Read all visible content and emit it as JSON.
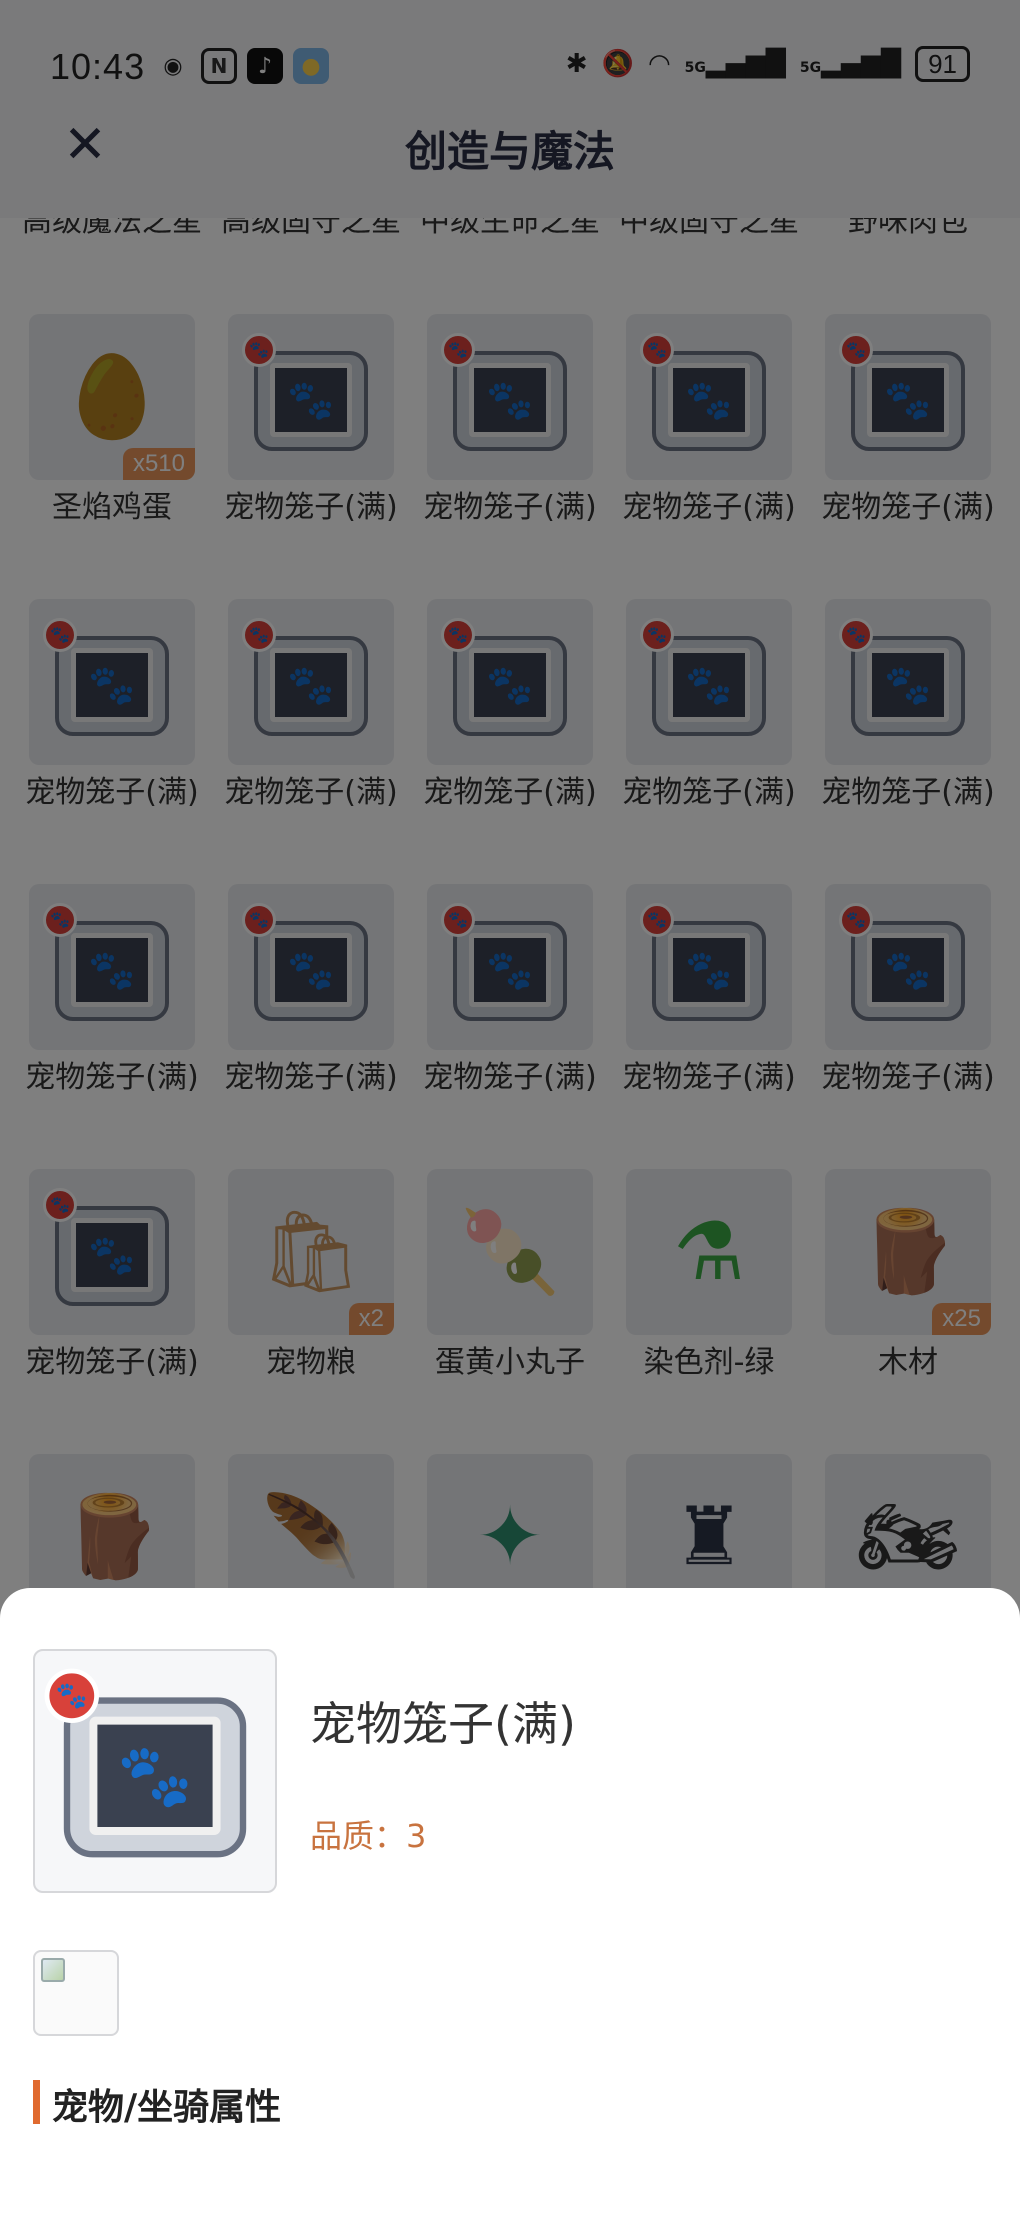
{
  "status_bar": {
    "time": "10:43",
    "battery": "91",
    "network1": "5G",
    "network2": "5G"
  },
  "header": {
    "title": "创造与魔法"
  },
  "grid": {
    "partial_row": [
      "高级魔法之星",
      "高级固守之星",
      "中级生命之星",
      "中级固守之星",
      "野味肉包"
    ],
    "rows": [
      [
        {
          "label": "圣焰鸡蛋",
          "badge": "x510",
          "icon": "egg-icon"
        },
        {
          "label": "宠物笼子(满)",
          "badge": "",
          "icon": "pet-cage-icon"
        },
        {
          "label": "宠物笼子(满)",
          "badge": "",
          "icon": "pet-cage-icon"
        },
        {
          "label": "宠物笼子(满)",
          "badge": "",
          "icon": "pet-cage-icon"
        },
        {
          "label": "宠物笼子(满)",
          "badge": "",
          "icon": "pet-cage-icon"
        }
      ],
      [
        {
          "label": "宠物笼子(满)",
          "badge": "",
          "icon": "pet-cage-icon"
        },
        {
          "label": "宠物笼子(满)",
          "badge": "",
          "icon": "pet-cage-icon"
        },
        {
          "label": "宠物笼子(满)",
          "badge": "",
          "icon": "pet-cage-icon"
        },
        {
          "label": "宠物笼子(满)",
          "badge": "",
          "icon": "pet-cage-icon"
        },
        {
          "label": "宠物笼子(满)",
          "badge": "",
          "icon": "pet-cage-icon"
        }
      ],
      [
        {
          "label": "宠物笼子(满)",
          "badge": "",
          "icon": "pet-cage-icon"
        },
        {
          "label": "宠物笼子(满)",
          "badge": "",
          "icon": "pet-cage-icon"
        },
        {
          "label": "宠物笼子(满)",
          "badge": "",
          "icon": "pet-cage-icon"
        },
        {
          "label": "宠物笼子(满)",
          "badge": "",
          "icon": "pet-cage-icon"
        },
        {
          "label": "宠物笼子(满)",
          "badge": "",
          "icon": "pet-cage-icon"
        }
      ],
      [
        {
          "label": "宠物笼子(满)",
          "badge": "",
          "icon": "pet-cage-icon"
        },
        {
          "label": "宠物粮",
          "badge": "x2",
          "icon": "pet-food-bag-icon"
        },
        {
          "label": "蛋黄小丸子",
          "badge": "",
          "icon": "skewer-icon"
        },
        {
          "label": "染色剂-绿",
          "badge": "",
          "icon": "green-dye-flask-icon"
        },
        {
          "label": "木材",
          "badge": "x25",
          "icon": "wood-log-icon"
        }
      ]
    ],
    "partial_bottom_icons": [
      "tree-stump-icon",
      "wood-bundle-icon",
      "green-orb-icon",
      "dark-statue-icon",
      "motorcycle-icon"
    ]
  },
  "detail": {
    "name": "宠物笼子(满)",
    "quality": "品质：3",
    "section_title": "宠物/坐骑属性"
  },
  "colors": {
    "accent": "#e06a2f",
    "quality_text": "#c8733f",
    "badge_bg": "#e9955a",
    "title_text": "#2a2f45"
  }
}
